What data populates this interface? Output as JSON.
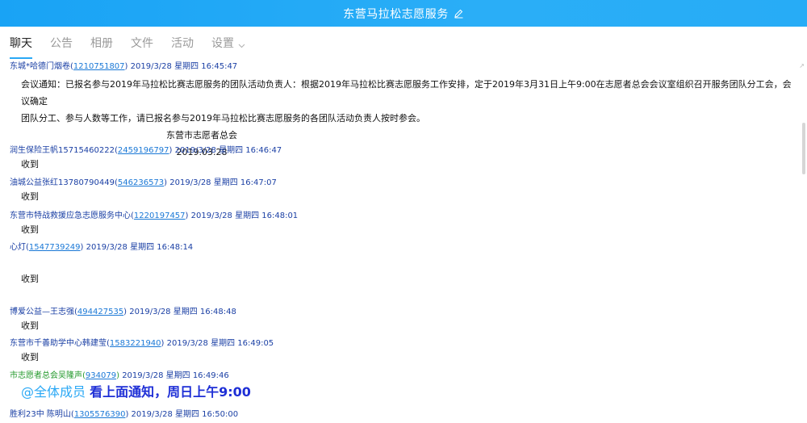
{
  "window": {
    "title": "东营马拉松志愿服务",
    "edit_icon": "pencil-icon"
  },
  "tabs": [
    {
      "label": "聊天",
      "active": true
    },
    {
      "label": "公告"
    },
    {
      "label": "相册"
    },
    {
      "label": "文件"
    },
    {
      "label": "活动"
    },
    {
      "label": "设置"
    }
  ],
  "messages": [
    {
      "sender": "东城*哈德门烟卷",
      "qq": "1210751807",
      "time": "2019/3/28 星期四 16:45:47",
      "notice_line1": "会议通知：已报名参与2019年马拉松比赛志愿服务的团队活动负责人：根据2019年马拉松比赛志愿服务工作安排，定于2019年3月31日上午9:00在志愿者总会会议室组织召开服务团队分工会，会议确定",
      "notice_line2": "团队分工、参与人数等工作，请已报名参与2019年马拉松比赛志愿服务的各团队活动负责人按时参会。",
      "signature": "东营市志愿者总会",
      "date": "2019.03.28"
    },
    {
      "sender": "润生保险王帆15715460222",
      "qq": "2459196797",
      "time": "2019/3/28 星期四 16:46:47",
      "text": "收到"
    },
    {
      "sender": "油城公益张红13780790449",
      "qq": "546236573",
      "time": "2019/3/28 星期四 16:47:07",
      "text": "收到"
    },
    {
      "sender": "东营市特战救援应急志愿服务中心",
      "qq": "1220197457",
      "time": "2019/3/28 星期四 16:48:01",
      "text": "收到"
    },
    {
      "sender": "心灯",
      "qq": "1547739249",
      "time": "2019/3/28 星期四 16:48:14",
      "text": "收到"
    },
    {
      "sender": "博爱公益—王志强",
      "qq": "494427535",
      "time": "2019/3/28 星期四 16:48:48",
      "text": "收到"
    },
    {
      "sender": "东营市千善助学中心韩建莹",
      "qq": "1583221940",
      "time": "2019/3/28 星期四 16:49:05",
      "text": "收到"
    },
    {
      "sender": "市志愿者总会吴隆声",
      "qq": "934079",
      "time": "2019/3/28 星期四 16:49:46",
      "at_text": "@全体成员",
      "bold_text": "看上面通知，周日上午9:00"
    },
    {
      "sender": "胜利23中 陈明山",
      "qq": "1305576390",
      "time": "2019/3/28 星期四 16:50:00"
    }
  ],
  "colors": {
    "titlebar": "#1ea6f6",
    "accent": "#2aa8f5",
    "sender": "#1a3fa4",
    "admin_sender": "#259a2d",
    "bold_text": "#1e2fd6"
  }
}
